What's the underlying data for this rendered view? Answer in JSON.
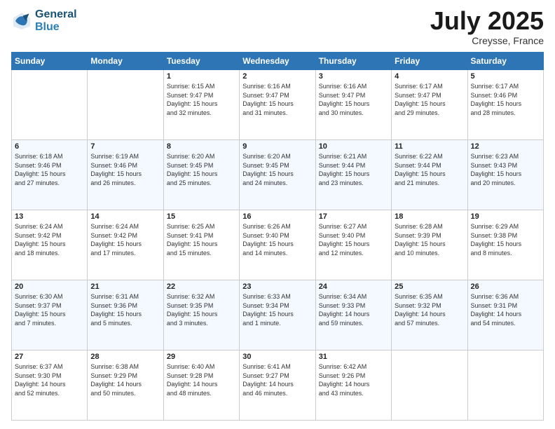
{
  "header": {
    "logo_line1": "General",
    "logo_line2": "Blue",
    "month_year": "July 2025",
    "location": "Creysse, France"
  },
  "days_of_week": [
    "Sunday",
    "Monday",
    "Tuesday",
    "Wednesday",
    "Thursday",
    "Friday",
    "Saturday"
  ],
  "weeks": [
    [
      {
        "day": "",
        "info": ""
      },
      {
        "day": "",
        "info": ""
      },
      {
        "day": "1",
        "info": "Sunrise: 6:15 AM\nSunset: 9:47 PM\nDaylight: 15 hours\nand 32 minutes."
      },
      {
        "day": "2",
        "info": "Sunrise: 6:16 AM\nSunset: 9:47 PM\nDaylight: 15 hours\nand 31 minutes."
      },
      {
        "day": "3",
        "info": "Sunrise: 6:16 AM\nSunset: 9:47 PM\nDaylight: 15 hours\nand 30 minutes."
      },
      {
        "day": "4",
        "info": "Sunrise: 6:17 AM\nSunset: 9:47 PM\nDaylight: 15 hours\nand 29 minutes."
      },
      {
        "day": "5",
        "info": "Sunrise: 6:17 AM\nSunset: 9:46 PM\nDaylight: 15 hours\nand 28 minutes."
      }
    ],
    [
      {
        "day": "6",
        "info": "Sunrise: 6:18 AM\nSunset: 9:46 PM\nDaylight: 15 hours\nand 27 minutes."
      },
      {
        "day": "7",
        "info": "Sunrise: 6:19 AM\nSunset: 9:46 PM\nDaylight: 15 hours\nand 26 minutes."
      },
      {
        "day": "8",
        "info": "Sunrise: 6:20 AM\nSunset: 9:45 PM\nDaylight: 15 hours\nand 25 minutes."
      },
      {
        "day": "9",
        "info": "Sunrise: 6:20 AM\nSunset: 9:45 PM\nDaylight: 15 hours\nand 24 minutes."
      },
      {
        "day": "10",
        "info": "Sunrise: 6:21 AM\nSunset: 9:44 PM\nDaylight: 15 hours\nand 23 minutes."
      },
      {
        "day": "11",
        "info": "Sunrise: 6:22 AM\nSunset: 9:44 PM\nDaylight: 15 hours\nand 21 minutes."
      },
      {
        "day": "12",
        "info": "Sunrise: 6:23 AM\nSunset: 9:43 PM\nDaylight: 15 hours\nand 20 minutes."
      }
    ],
    [
      {
        "day": "13",
        "info": "Sunrise: 6:24 AM\nSunset: 9:42 PM\nDaylight: 15 hours\nand 18 minutes."
      },
      {
        "day": "14",
        "info": "Sunrise: 6:24 AM\nSunset: 9:42 PM\nDaylight: 15 hours\nand 17 minutes."
      },
      {
        "day": "15",
        "info": "Sunrise: 6:25 AM\nSunset: 9:41 PM\nDaylight: 15 hours\nand 15 minutes."
      },
      {
        "day": "16",
        "info": "Sunrise: 6:26 AM\nSunset: 9:40 PM\nDaylight: 15 hours\nand 14 minutes."
      },
      {
        "day": "17",
        "info": "Sunrise: 6:27 AM\nSunset: 9:40 PM\nDaylight: 15 hours\nand 12 minutes."
      },
      {
        "day": "18",
        "info": "Sunrise: 6:28 AM\nSunset: 9:39 PM\nDaylight: 15 hours\nand 10 minutes."
      },
      {
        "day": "19",
        "info": "Sunrise: 6:29 AM\nSunset: 9:38 PM\nDaylight: 15 hours\nand 8 minutes."
      }
    ],
    [
      {
        "day": "20",
        "info": "Sunrise: 6:30 AM\nSunset: 9:37 PM\nDaylight: 15 hours\nand 7 minutes."
      },
      {
        "day": "21",
        "info": "Sunrise: 6:31 AM\nSunset: 9:36 PM\nDaylight: 15 hours\nand 5 minutes."
      },
      {
        "day": "22",
        "info": "Sunrise: 6:32 AM\nSunset: 9:35 PM\nDaylight: 15 hours\nand 3 minutes."
      },
      {
        "day": "23",
        "info": "Sunrise: 6:33 AM\nSunset: 9:34 PM\nDaylight: 15 hours\nand 1 minute."
      },
      {
        "day": "24",
        "info": "Sunrise: 6:34 AM\nSunset: 9:33 PM\nDaylight: 14 hours\nand 59 minutes."
      },
      {
        "day": "25",
        "info": "Sunrise: 6:35 AM\nSunset: 9:32 PM\nDaylight: 14 hours\nand 57 minutes."
      },
      {
        "day": "26",
        "info": "Sunrise: 6:36 AM\nSunset: 9:31 PM\nDaylight: 14 hours\nand 54 minutes."
      }
    ],
    [
      {
        "day": "27",
        "info": "Sunrise: 6:37 AM\nSunset: 9:30 PM\nDaylight: 14 hours\nand 52 minutes."
      },
      {
        "day": "28",
        "info": "Sunrise: 6:38 AM\nSunset: 9:29 PM\nDaylight: 14 hours\nand 50 minutes."
      },
      {
        "day": "29",
        "info": "Sunrise: 6:40 AM\nSunset: 9:28 PM\nDaylight: 14 hours\nand 48 minutes."
      },
      {
        "day": "30",
        "info": "Sunrise: 6:41 AM\nSunset: 9:27 PM\nDaylight: 14 hours\nand 46 minutes."
      },
      {
        "day": "31",
        "info": "Sunrise: 6:42 AM\nSunset: 9:26 PM\nDaylight: 14 hours\nand 43 minutes."
      },
      {
        "day": "",
        "info": ""
      },
      {
        "day": "",
        "info": ""
      }
    ]
  ]
}
